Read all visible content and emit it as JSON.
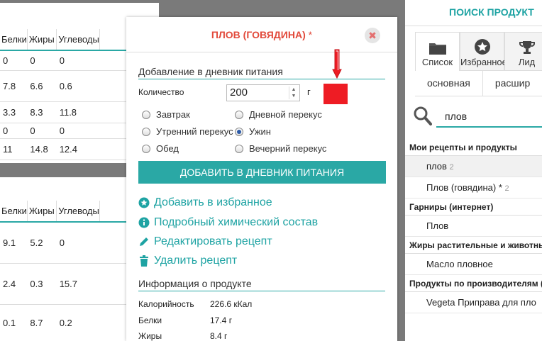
{
  "table1": {
    "headers": [
      "Белки",
      "Жиры",
      "Углеводы"
    ],
    "rows": [
      [
        "0",
        "0",
        "0"
      ],
      [
        "7.8",
        "6.6",
        "0.6"
      ],
      [
        "3.3",
        "8.3",
        "11.8"
      ],
      [
        "0",
        "0",
        "0"
      ],
      [
        "11",
        "14.8",
        "12.4"
      ]
    ]
  },
  "table2": {
    "headers": [
      "Белки",
      "Жиры",
      "Углеводы"
    ],
    "rows": [
      [
        "9.1",
        "5.2",
        "0"
      ],
      [
        "2.4",
        "0.3",
        "15.7"
      ],
      [
        "0.1",
        "8.7",
        "0.2"
      ]
    ]
  },
  "right_panel": {
    "title": "ПОИСК ПРОДУКТ",
    "tabs": [
      {
        "label": "Список",
        "icon": "folder-icon"
      },
      {
        "label": "Избранное",
        "icon": "star-icon"
      },
      {
        "label": "Лид",
        "icon": "trophy-icon"
      }
    ],
    "subtabs": [
      "основная",
      "расшир"
    ],
    "search_value": "плов",
    "groups": [
      {
        "title": "Мои рецепты и продукты",
        "items": [
          {
            "label": "плов",
            "count": "2"
          },
          {
            "label": "Плов (говядина) *",
            "count": "2"
          }
        ]
      },
      {
        "title": "Гарниры (интернет)",
        "items": [
          {
            "label": "Плов",
            "count": ""
          }
        ]
      },
      {
        "title": "Жиры растительные и животные",
        "items": [
          {
            "label": "Масло пловное",
            "count": ""
          }
        ]
      },
      {
        "title": "Продукты по производителям (т",
        "items": [
          {
            "label": "Vegeta Приправа для пло",
            "count": ""
          }
        ]
      }
    ]
  },
  "modal": {
    "title": "ПЛОВ (ГОВЯДИНА)",
    "title_star": "*",
    "close_icon": "✖",
    "section_add": "Добавление в дневник питания",
    "quantity_label": "Количество",
    "quantity_value": "200",
    "quantity_unit": "г",
    "highlight_color": "#ee1c24",
    "meals": [
      {
        "label": "Завтрак",
        "checked": false
      },
      {
        "label": "Дневной перекус",
        "checked": false
      },
      {
        "label": "Утренний перекус",
        "checked": false
      },
      {
        "label": "Ужин",
        "checked": true
      },
      {
        "label": "Обед",
        "checked": false
      },
      {
        "label": "Вечерний перекус",
        "checked": false
      }
    ],
    "add_button": "ДОБАВИТЬ В ДНЕВНИК ПИТАНИЯ",
    "actions": [
      {
        "label": "Добавить в избранное",
        "icon": "star-circle-icon"
      },
      {
        "label": "Подробный химический состав",
        "icon": "info-icon"
      },
      {
        "label": "Редактировать рецепт",
        "icon": "pencil-icon"
      },
      {
        "label": "Удалить рецепт",
        "icon": "trash-icon"
      }
    ],
    "section_info": "Информация о продукте",
    "info": [
      {
        "k": "Калорийность",
        "v": "226.6 кКал"
      },
      {
        "k": "Белки",
        "v": "17.4 г"
      },
      {
        "k": "Жиры",
        "v": "8.4 г"
      }
    ],
    "accent": "#2aa8a5"
  }
}
